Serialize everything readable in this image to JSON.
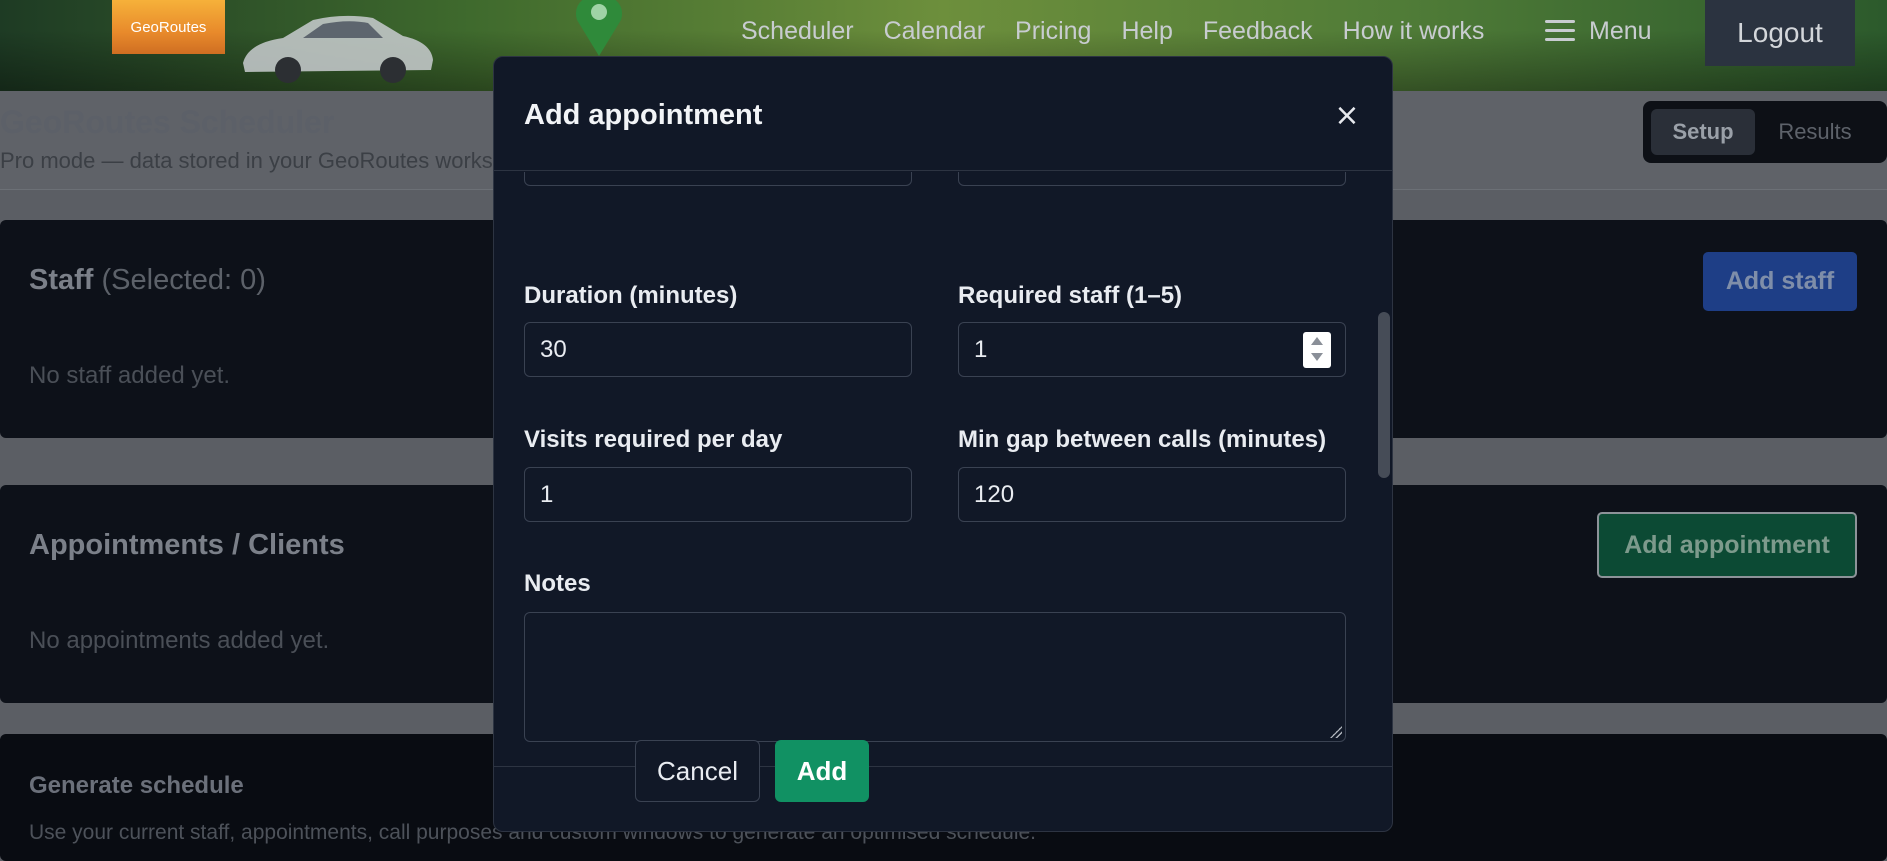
{
  "nav": {
    "logo_text": "GeoRoutes",
    "links": [
      "Scheduler",
      "Calendar",
      "Pricing",
      "Help",
      "Feedback",
      "How it works"
    ],
    "menu_label": "Menu",
    "logout_label": "Logout"
  },
  "page": {
    "title": "GeoRoutes Scheduler",
    "subtitle": "Pro mode — data stored in your GeoRoutes works",
    "segmented": {
      "active": "Setup",
      "inactive": "Results"
    }
  },
  "staff_card": {
    "title": "Staff",
    "selected_text": "(Selected: 0)",
    "empty_text": "No staff added yet.",
    "button_label": "Add staff"
  },
  "appointments_card": {
    "title": "Appointments / Clients",
    "empty_text": "No appointments added yet.",
    "button_label": "Add appointment"
  },
  "generate_card": {
    "title": "Generate schedule",
    "text": "Use your current staff, appointments, call purposes and custom windows to generate an optimised schedule."
  },
  "modal": {
    "title": "Add appointment",
    "close_glyph": "×",
    "fields": {
      "duration": {
        "label": "Duration (minutes)",
        "value": "30"
      },
      "required_staff": {
        "label": "Required staff (1–5)",
        "value": "1"
      },
      "visits_per_day": {
        "label": "Visits required per day",
        "value": "1"
      },
      "min_gap": {
        "label": "Min gap between calls (minutes)",
        "value": "120"
      },
      "notes": {
        "label": "Notes",
        "value": ""
      }
    },
    "cancel_label": "Cancel",
    "add_label": "Add"
  },
  "colors": {
    "accent_green": "#119163",
    "modal_bg": "#111827"
  }
}
